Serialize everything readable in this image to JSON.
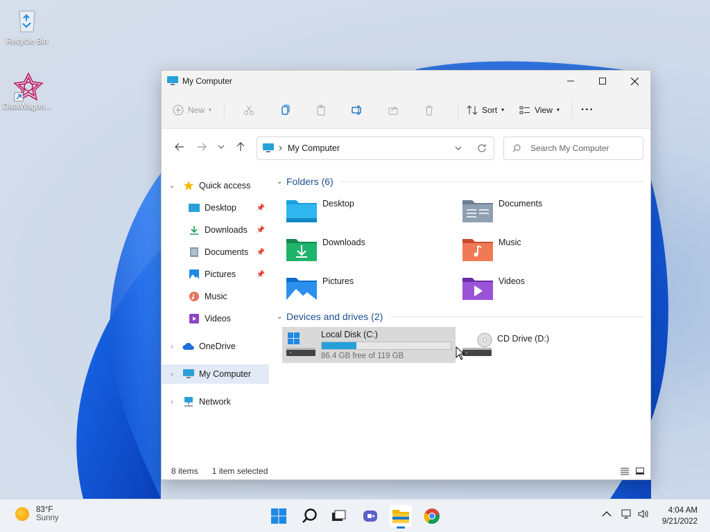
{
  "desktop": {
    "icons": [
      {
        "label": "Recycle Bin",
        "icon": "recycle-bin-icon"
      },
      {
        "label": "DataWagon...",
        "icon": "datawagon-shortcut-icon"
      }
    ]
  },
  "window": {
    "title": "My Computer",
    "controls": {
      "minimize": "minimize",
      "maximize": "maximize",
      "close": "close"
    }
  },
  "toolbar": {
    "new_label": "New",
    "sort_label": "Sort",
    "view_label": "View",
    "more_label": "···",
    "icons": [
      "cut-icon",
      "copy-icon",
      "paste-icon",
      "rename-icon",
      "share-icon",
      "delete-icon"
    ]
  },
  "address": {
    "path": "My Computer",
    "search_placeholder": "Search My Computer"
  },
  "nav": {
    "quick_access": "Quick access",
    "items": [
      {
        "label": "Desktop",
        "pinned": true
      },
      {
        "label": "Downloads",
        "pinned": true
      },
      {
        "label": "Documents",
        "pinned": true
      },
      {
        "label": "Pictures",
        "pinned": true
      },
      {
        "label": "Music",
        "pinned": false
      },
      {
        "label": "Videos",
        "pinned": false
      }
    ],
    "onedrive": "OneDrive",
    "my_computer": "My Computer",
    "network": "Network"
  },
  "content": {
    "folders_header": "Folders (6)",
    "folders": [
      "Desktop",
      "Documents",
      "Downloads",
      "Music",
      "Pictures",
      "Videos"
    ],
    "drives_header": "Devices and drives (2)",
    "drives": [
      {
        "name": "Local Disk (C:)",
        "free": "86.4 GB free of 119 GB",
        "used_fraction": 0.27
      },
      {
        "name": "CD Drive (D:)"
      }
    ]
  },
  "status": {
    "items": "8 items",
    "selected": "1 item selected"
  },
  "taskbar": {
    "weather": {
      "temp": "83°F",
      "condition": "Sunny"
    },
    "apps": [
      "start-icon",
      "search-icon",
      "task-view-icon",
      "chat-icon",
      "file-explorer-icon",
      "chrome-icon"
    ],
    "time": "4:04 AM",
    "date": "9/21/2022"
  },
  "colors": {
    "accent": "#1976d2",
    "selection": "#e1eaf6",
    "drive_bar": "#26a0da",
    "group_header": "#1f4e8c"
  }
}
